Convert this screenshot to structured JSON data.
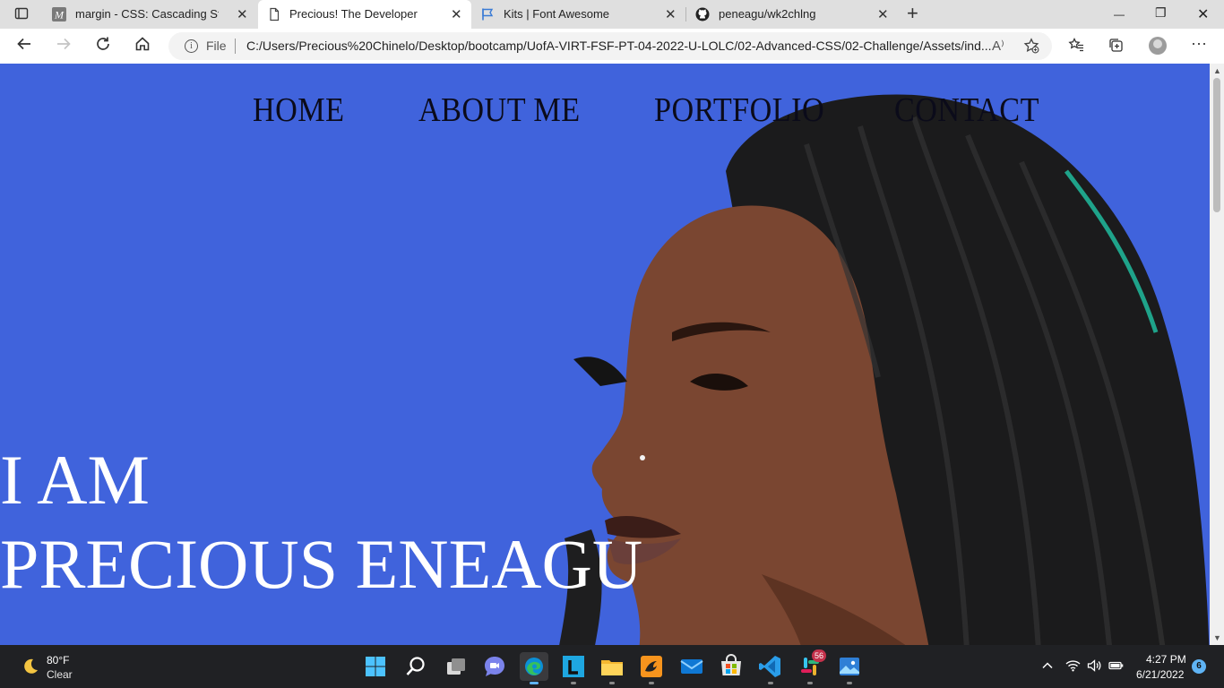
{
  "browser": {
    "tabs": [
      {
        "title": "margin - CSS: Cascading Style Sh",
        "favicon": "mdn-m-icon",
        "close": "✕"
      },
      {
        "title": "Precious! The Developer",
        "favicon": "page-icon",
        "close": "✕",
        "active": true
      },
      {
        "title": "Kits | Font Awesome",
        "favicon": "font-awesome-flag-icon",
        "close": "✕"
      },
      {
        "title": "peneagu/wk2chlng",
        "favicon": "github-icon",
        "close": "✕"
      }
    ],
    "new_tab": "+",
    "window_controls": {
      "minimize": "—",
      "restore": "❐",
      "close": "✕"
    },
    "address": {
      "scheme_label": "File",
      "url": "C:/Users/Precious%20Chinelo/Desktop/bootcamp/UofA-VIRT-FSF-PT-04-2022-U-LOLC/02-Advanced-CSS/02-Challenge/Assets/ind...",
      "read_aloud": "A⁾"
    },
    "colors": {
      "tabstrip": "#dfdfdf",
      "omnibox": "#f3f3f3"
    }
  },
  "page": {
    "nav": [
      {
        "label": "HOME"
      },
      {
        "label": "ABOUT ME"
      },
      {
        "label": "PORTFOLIO"
      },
      {
        "label": "CONTACT"
      }
    ],
    "hero": {
      "line1": "I AM",
      "line2": "PRECIOUS ENEAGU"
    },
    "colors": {
      "background": "#4063dc",
      "nav_text": "#0b0b1a",
      "hero_text": "#ffffff"
    }
  },
  "taskbar": {
    "weather": {
      "temp": "80°F",
      "condition": "Clear",
      "icon": "moon-icon"
    },
    "apps": [
      "windows-start-icon",
      "search-icon",
      "task-view-icon",
      "teams-chat-icon",
      "edge-icon",
      "l-app-icon",
      "file-explorer-icon",
      "ink-app-icon",
      "mail-icon",
      "store-icon",
      "vscode-icon",
      "slack-icon",
      "photos-icon"
    ],
    "slack_badge": "56",
    "clock": {
      "time": "4:27 PM",
      "date": "6/21/2022"
    },
    "notifications": "6"
  }
}
